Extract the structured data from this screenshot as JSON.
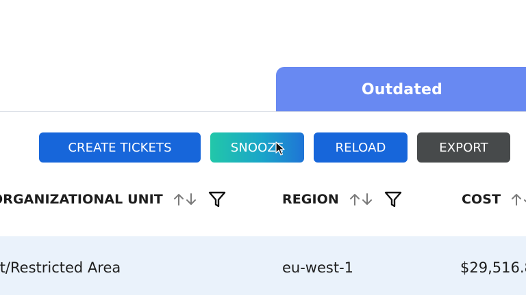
{
  "tab": {
    "label": "Outdated"
  },
  "toolbar": {
    "create_tickets": "CREATE TICKETS",
    "snooze": "SNOOZE",
    "reload": "RELOAD",
    "export": "EXPORT"
  },
  "table": {
    "columns": [
      {
        "label": "ORGANIZATIONAL UNIT",
        "sortable": true,
        "filterable": true
      },
      {
        "label": "REGION",
        "sortable": true,
        "filterable": true
      },
      {
        "label": "COST",
        "sortable": true,
        "filterable": false
      }
    ],
    "rows": [
      {
        "org_unit": "oot/Restricted Area",
        "region": "eu-west-1",
        "cost": "$29,516.8"
      }
    ]
  },
  "colors": {
    "tab": "#6889f2",
    "primary_button": "#1766da",
    "snooze_button_start": "#22c7a9",
    "export_button": "#474a4b",
    "row_highlight": "#eaf2fb"
  },
  "icons": [
    "sort-arrows-icon",
    "filter-icon",
    "mouse-cursor-icon"
  ]
}
